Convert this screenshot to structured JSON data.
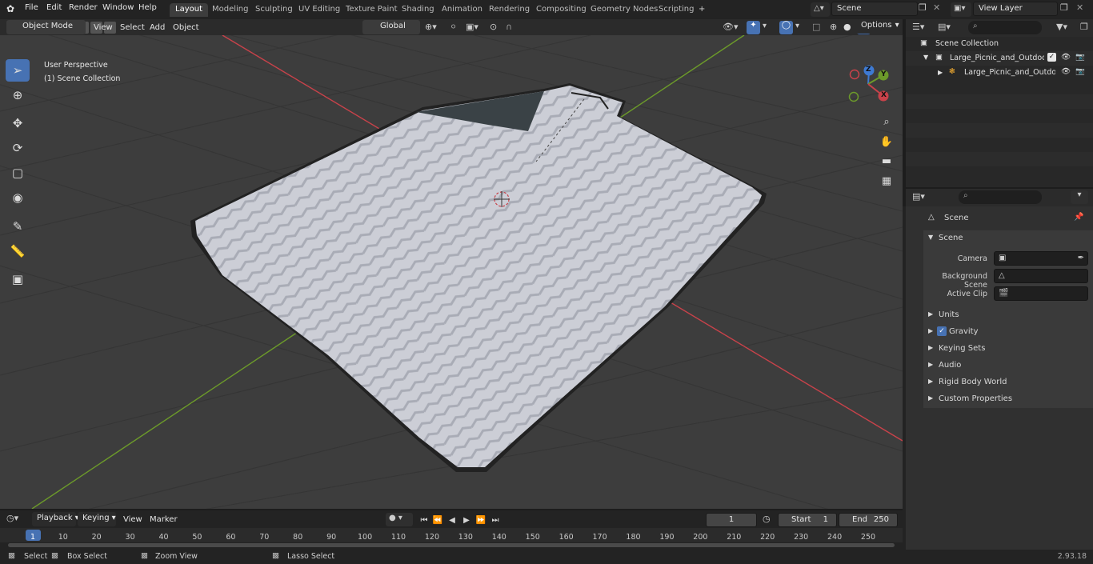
{
  "topbar": {
    "menus": [
      "File",
      "Edit",
      "Render",
      "Window",
      "Help"
    ],
    "workspaces": [
      "Layout",
      "Modeling",
      "Sculpting",
      "UV Editing",
      "Texture Paint",
      "Shading",
      "Animation",
      "Rendering",
      "Compositing",
      "Geometry Nodes",
      "Scripting"
    ],
    "active_workspace": "Layout",
    "add_tab": "+",
    "scene": "Scene",
    "view_layer": "View Layer"
  },
  "viewport_header": {
    "mode": "Object Mode",
    "menus": [
      "View",
      "Select",
      "Add",
      "Object"
    ],
    "transform_orientation": "Global",
    "options": "Options"
  },
  "viewport": {
    "perspective": "User Perspective",
    "collection": "(1) Scene Collection",
    "gizmo_axes": [
      "Z",
      "Y",
      "X"
    ]
  },
  "outliner": {
    "root": "Scene Collection",
    "collection": "Large_Picnic_and_Outdoor_Bl",
    "object": "Large_Picnic_and_Outdoo"
  },
  "properties": {
    "context": "Scene",
    "section": "Scene",
    "fields": [
      {
        "label": "Camera",
        "value": ""
      },
      {
        "label": "Background Scene",
        "value": ""
      },
      {
        "label": "Active Clip",
        "value": ""
      }
    ],
    "panels": [
      "Units",
      "Gravity",
      "Keying Sets",
      "Audio",
      "Rigid Body World",
      "Custom Properties"
    ],
    "gravity_checked": true
  },
  "timeline": {
    "menus": [
      "Playback",
      "Keying",
      "View",
      "Marker"
    ],
    "current_frame": "1",
    "start_label": "Start",
    "start": "1",
    "end_label": "End",
    "end": "250",
    "ruler": [
      "1",
      "10",
      "20",
      "30",
      "40",
      "50",
      "60",
      "70",
      "80",
      "90",
      "100",
      "110",
      "120",
      "130",
      "140",
      "150",
      "160",
      "170",
      "180",
      "190",
      "200",
      "210",
      "220",
      "230",
      "240",
      "250"
    ]
  },
  "statusbar": {
    "items": [
      "Select",
      "Box Select",
      "Zoom View",
      "Lasso Select"
    ],
    "version": "2.93.18"
  },
  "colors": {
    "accent": "#4772b3",
    "x_axis": "#c8424a",
    "y_axis": "#6c9a2a",
    "z_axis": "#3e7ad2",
    "viewport_bg": "#3d3d3d",
    "blanket": "#c9ccd4"
  }
}
